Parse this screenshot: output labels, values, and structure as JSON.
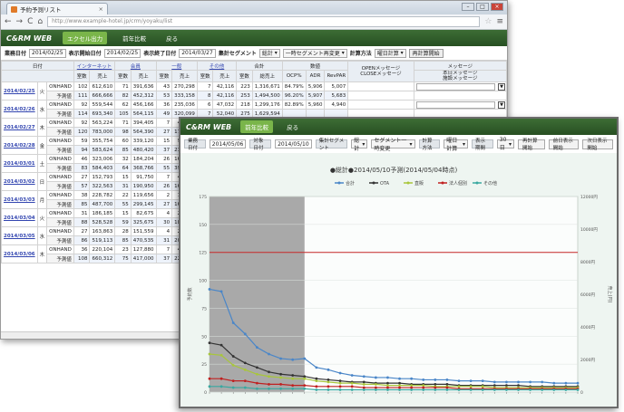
{
  "window1": {
    "tab_title": "予約予測リスト",
    "tab_close": "×",
    "nav": {
      "back": "←",
      "forward": "→",
      "reload": "C",
      "home": "⌂"
    },
    "url": "http://www.example-hotel.jp/crm/yoyaku/list",
    "star": "☆",
    "menu": "≡",
    "win_buttons": {
      "min": "–",
      "max": "□",
      "close": "×"
    }
  },
  "brand": {
    "logo": "C&RM WEB",
    "excel_button": "エクセル出力",
    "prev_compare_button": "前年比較",
    "back_button": "戻る"
  },
  "filters": {
    "business_date_label": "業務日付",
    "business_date": "2014/02/25",
    "start_label": "表示開始日付",
    "start_date": "2014/02/25",
    "end_label": "表示終了日付",
    "end_date": "2014/03/27",
    "segment_label": "集計セグメント",
    "segment_value": "総計",
    "segment_mode": "一時セグメント再変更",
    "method_label": "計算方法",
    "method_value": "曜日計算",
    "recalc_button": "再計算開始"
  },
  "table": {
    "col_date": "日付",
    "groups": [
      "インターネット",
      "会員",
      "一般",
      "その他",
      "合計",
      "数値"
    ],
    "open_close_header": "OPENメッセージ\nCLOSEメッセージ",
    "message_header": "メッセージ",
    "today_msg_header": "本日メッセージ\n施設メッセージ",
    "sub_headers": [
      "室数",
      "売上",
      "室数",
      "売上",
      "室数",
      "売上",
      "室数",
      "売上",
      "室数",
      "総売上",
      "OCP%",
      "ADR",
      "RevPAR"
    ],
    "arrow_glyph": "▼",
    "rows": [
      {
        "date": "2014/02/25",
        "wd": "火",
        "oh": [
          "102",
          "612,610",
          "71",
          "391,636",
          "43",
          "270,298",
          "7",
          "42,116",
          "223",
          "1,316,671",
          "84.79%",
          "5,906",
          "5,007"
        ],
        "fc": [
          "111",
          "666,666",
          "82",
          "452,312",
          "53",
          "333,158",
          "8",
          "42,116",
          "253",
          "1,494,500",
          "96.20%",
          "5,907",
          "5,683"
        ]
      },
      {
        "date": "2014/02/26",
        "wd": "水",
        "oh": [
          "92",
          "559,544",
          "62",
          "456,166",
          "36",
          "235,036",
          "6",
          "47,032",
          "218",
          "1,299,176",
          "82.89%",
          "5,960",
          "4,940"
        ],
        "fc": [
          "114",
          "693,340",
          "105",
          "564,115",
          "49",
          "320,099",
          "7",
          "52,040",
          "275",
          "1,629,594",
          "",
          "",
          ""
        ]
      },
      {
        "date": "2014/02/27",
        "wd": "木",
        "oh": [
          "92",
          "563,224",
          "71",
          "394,405",
          "7",
          "44,114",
          "",
          "",
          "",
          "",
          "",
          "",
          ""
        ],
        "fc": [
          "120",
          "783,000",
          "98",
          "564,390",
          "27",
          "176,154",
          "",
          "",
          "",
          "",
          "",
          "",
          ""
        ]
      },
      {
        "date": "2014/02/28",
        "wd": "金",
        "oh": [
          "59",
          "355,754",
          "60",
          "339,120",
          "15",
          "95,165",
          "",
          "",
          "",
          "",
          "",
          "",
          ""
        ],
        "fc": [
          "94",
          "583,624",
          "85",
          "480,420",
          "37",
          "237,207",
          "",
          "",
          "",
          "",
          "",
          "",
          ""
        ]
      },
      {
        "date": "2014/03/01",
        "wd": "土",
        "oh": [
          "46",
          "323,006",
          "32",
          "184,204",
          "26",
          "166,914",
          "",
          "",
          "",
          "",
          "",
          "",
          ""
        ],
        "fc": [
          "83",
          "584,403",
          "64",
          "368,766",
          "55",
          "395,395",
          "",
          "",
          "",
          "",
          "",
          "",
          ""
        ]
      },
      {
        "date": "2014/03/02",
        "wd": "日",
        "oh": [
          "27",
          "152,793",
          "15",
          "91,750",
          "7",
          "43,232",
          "",
          "",
          "",
          "",
          "",
          "",
          ""
        ],
        "fc": [
          "57",
          "322,563",
          "31",
          "190,950",
          "26",
          "160,576",
          "",
          "",
          "",
          "",
          "",
          "",
          ""
        ]
      },
      {
        "date": "2014/03/03",
        "wd": "月",
        "oh": [
          "38",
          "228,782",
          "22",
          "119,656",
          "2",
          "12,050",
          "",
          "",
          "",
          "",
          "",
          "",
          ""
        ],
        "fc": [
          "85",
          "487,700",
          "55",
          "299,145",
          "27",
          "162,675",
          "",
          "",
          "",
          "",
          "",
          "",
          ""
        ]
      },
      {
        "date": "2014/03/04",
        "wd": "火",
        "oh": [
          "31",
          "186,185",
          "15",
          "82,675",
          "4",
          "25,152",
          "",
          "",
          "",
          "",
          "",
          "",
          ""
        ],
        "fc": [
          "88",
          "528,528",
          "59",
          "325,675",
          "30",
          "188,640",
          "",
          "",
          "",
          "",
          "",
          "",
          ""
        ]
      },
      {
        "date": "2014/03/05",
        "wd": "水",
        "oh": [
          "27",
          "163,863",
          "28",
          "151,559",
          "4",
          "26,036",
          "",
          "",
          "",
          "",
          "",
          "",
          ""
        ],
        "fc": [
          "86",
          "519,113",
          "85",
          "470,535",
          "31",
          "201,779",
          "",
          "",
          "",
          "",
          "",
          "",
          ""
        ]
      },
      {
        "date": "2014/03/06",
        "wd": "木",
        "oh": [
          "36",
          "220,104",
          "23",
          "127,880",
          "7",
          "43,512",
          "",
          "",
          "",
          "",
          "",
          "",
          ""
        ],
        "fc": [
          "108",
          "660,312",
          "75",
          "417,000",
          "37",
          "229,992",
          "",
          "",
          "",
          "",
          "",
          "",
          ""
        ]
      }
    ],
    "kind_onhand": "ONHAND",
    "kind_forecast": "予測値"
  },
  "window2": {
    "brand_logo": "C&RM WEB",
    "btn_a": "前年比較",
    "btn_b": "戻る",
    "filters": {
      "business_date_label": "業務日付",
      "business_date": "2014/05/06",
      "end_label": "対象日付",
      "end_date": "2014/05/10",
      "segment_label": "集計セグメント",
      "segment_value": "総計",
      "segment_mode": "セグメント一時変更",
      "method_label": "計算方法",
      "method_value": "曜日計算",
      "range_label": "表示期間",
      "range_value": "30日",
      "btn_recalc": "再計算開始",
      "btn_prev": "前日表示開始",
      "btn_next": "次日表示開始"
    }
  },
  "chart_data": {
    "type": "line",
    "title": "●総計●2014/05/10予測(2014/05/04時点)",
    "legend": [
      "合計",
      "OTA",
      "直販",
      "法人個別",
      "その他"
    ],
    "colors": [
      "#4a86c8",
      "#333333",
      "#a8c63b",
      "#c02020",
      "#39a8a0"
    ],
    "ylabel_left": "予約数",
    "ylabel_right": "売上(円)",
    "left_ticks": [
      "0",
      "25",
      "50",
      "75",
      "100",
      "125",
      "150",
      "175"
    ],
    "right_ticks": [
      "0",
      "2000円",
      "4000円",
      "6000円",
      "8000円",
      "10000円",
      "12000円"
    ],
    "ylim": [
      0,
      175
    ],
    "capacity": 125,
    "n_points": 32,
    "shaded_until": 8,
    "series": [
      {
        "name": "合計",
        "values": [
          92,
          90,
          62,
          52,
          40,
          34,
          30,
          29,
          30,
          22,
          20,
          17,
          15,
          14,
          13,
          13,
          12,
          12,
          11,
          11,
          11,
          10,
          10,
          10,
          9,
          9,
          9,
          9,
          9,
          8,
          8,
          8
        ]
      },
      {
        "name": "OTA",
        "values": [
          44,
          42,
          32,
          26,
          22,
          18,
          16,
          15,
          14,
          12,
          11,
          10,
          9,
          9,
          8,
          8,
          8,
          7,
          7,
          7,
          7,
          6,
          6,
          6,
          6,
          6,
          6,
          5,
          5,
          5,
          5,
          5
        ]
      },
      {
        "name": "直販",
        "values": [
          34,
          33,
          24,
          20,
          16,
          14,
          13,
          12,
          12,
          10,
          9,
          8,
          8,
          7,
          7,
          6,
          6,
          6,
          6,
          5,
          5,
          5,
          5,
          5,
          4,
          4,
          4,
          4,
          4,
          4,
          4,
          4
        ]
      },
      {
        "name": "法人個別",
        "values": [
          12,
          12,
          10,
          10,
          8,
          7,
          7,
          6,
          6,
          5,
          5,
          5,
          5,
          4,
          4,
          4,
          4,
          4,
          4,
          4,
          4,
          3,
          3,
          3,
          3,
          3,
          3,
          3,
          3,
          3,
          3,
          3
        ]
      },
      {
        "name": "その他",
        "values": [
          5,
          5,
          4,
          4,
          3,
          3,
          3,
          3,
          3,
          2,
          2,
          2,
          2,
          2,
          2,
          2,
          2,
          2,
          2,
          2,
          2,
          2,
          2,
          2,
          2,
          2,
          2,
          2,
          2,
          2,
          2,
          2
        ]
      }
    ]
  }
}
